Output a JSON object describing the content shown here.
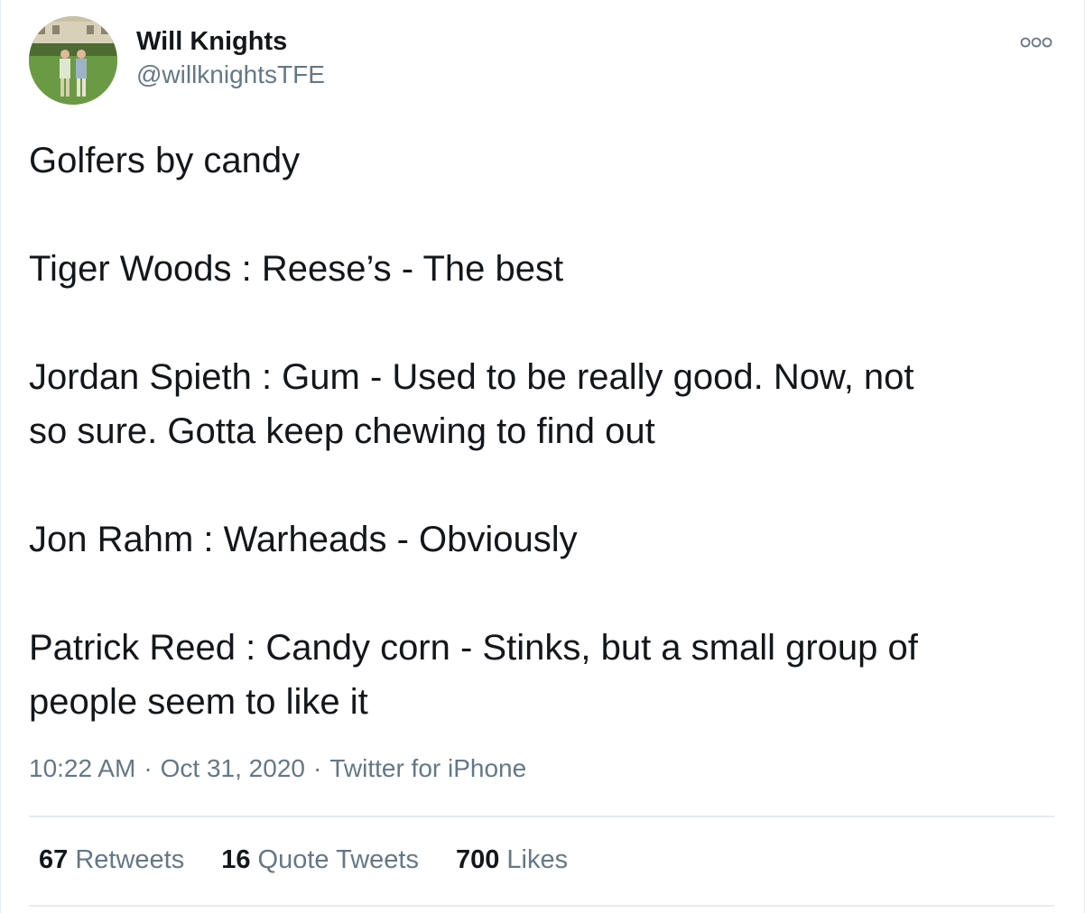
{
  "author": {
    "display_name": "Will Knights",
    "handle": "@willknightsTFE"
  },
  "icons": {
    "more": "more-options-icon",
    "avatar": "profile-photo"
  },
  "tweet": {
    "paragraphs": [
      [
        "Golfers by candy"
      ],
      [
        "Tiger Woods : Reese’s - The best"
      ],
      [
        "Jordan Spieth : Gum - Used to be really good. Now, not",
        "so sure. Gotta keep chewing to find out"
      ],
      [
        "Jon Rahm : Warheads - Obviously"
      ],
      [
        "Patrick Reed : Candy corn - Stinks, but a small group of",
        "people seem to like it"
      ]
    ]
  },
  "meta": {
    "time": "10:22 AM",
    "separator": "·",
    "date": "Oct 31, 2020",
    "source": "Twitter for iPhone"
  },
  "stats": {
    "retweets": {
      "count": "67",
      "label": "Retweets"
    },
    "quotes": {
      "count": "16",
      "label": "Quote Tweets"
    },
    "likes": {
      "count": "700",
      "label": "Likes"
    }
  },
  "colors": {
    "primary_text": "#14171a",
    "secondary_text": "#657786",
    "divider": "#e6ecf0"
  }
}
